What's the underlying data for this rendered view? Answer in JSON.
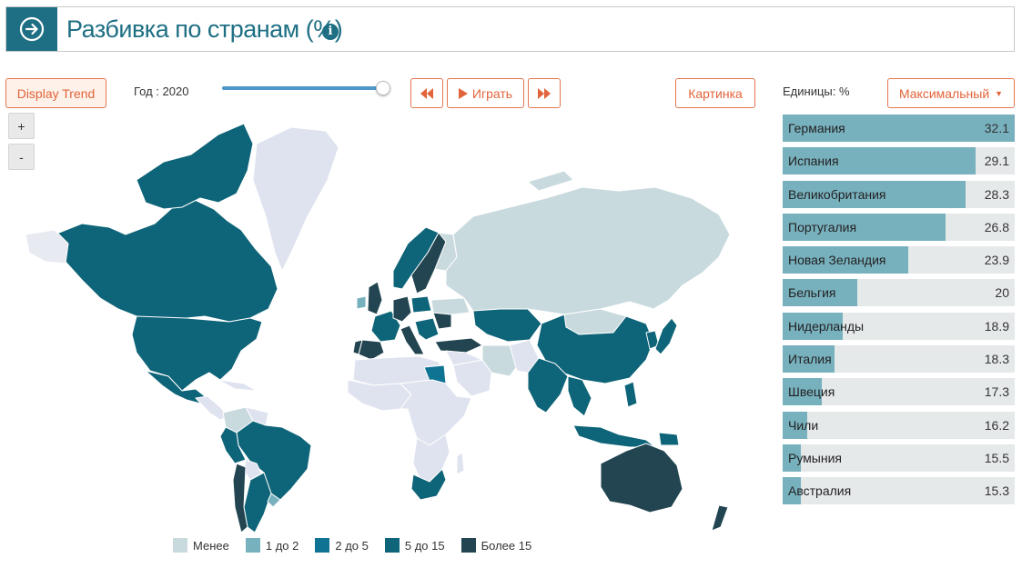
{
  "header": {
    "title": "Разбивка по странам (%)"
  },
  "controls": {
    "display_trend": "Display Trend",
    "year_label": "Год : 2020",
    "slider_value": 1.0,
    "play": "Играть",
    "picture": "Картинка",
    "units": "Единицы: %",
    "sort": "Максимальный"
  },
  "zoom": {
    "in": "+",
    "out": "-"
  },
  "legend": [
    {
      "label": "Менее",
      "color": "#c9dade"
    },
    {
      "label": "1 до 2",
      "color": "#78b1be"
    },
    {
      "label": "2 до 5",
      "color": "#0f7393"
    },
    {
      "label": "5 до 15",
      "color": "#0e6478"
    },
    {
      "label": "Более 15",
      "color": "#224551"
    }
  ],
  "bars": [
    {
      "country": "Германия",
      "value": 32.1
    },
    {
      "country": "Испания",
      "value": 29.1
    },
    {
      "country": "Великобритания",
      "value": 28.3
    },
    {
      "country": "Португалия",
      "value": 26.8
    },
    {
      "country": "Новая Зеландия",
      "value": 23.9
    },
    {
      "country": "Бельгия",
      "value": 20
    },
    {
      "country": "Нидерланды",
      "value": 18.9
    },
    {
      "country": "Италия",
      "value": 18.3
    },
    {
      "country": "Швеция",
      "value": 17.3
    },
    {
      "country": "Чили",
      "value": 16.2
    },
    {
      "country": "Румыния",
      "value": 15.5
    },
    {
      "country": "Австралия",
      "value": 15.3
    }
  ]
}
